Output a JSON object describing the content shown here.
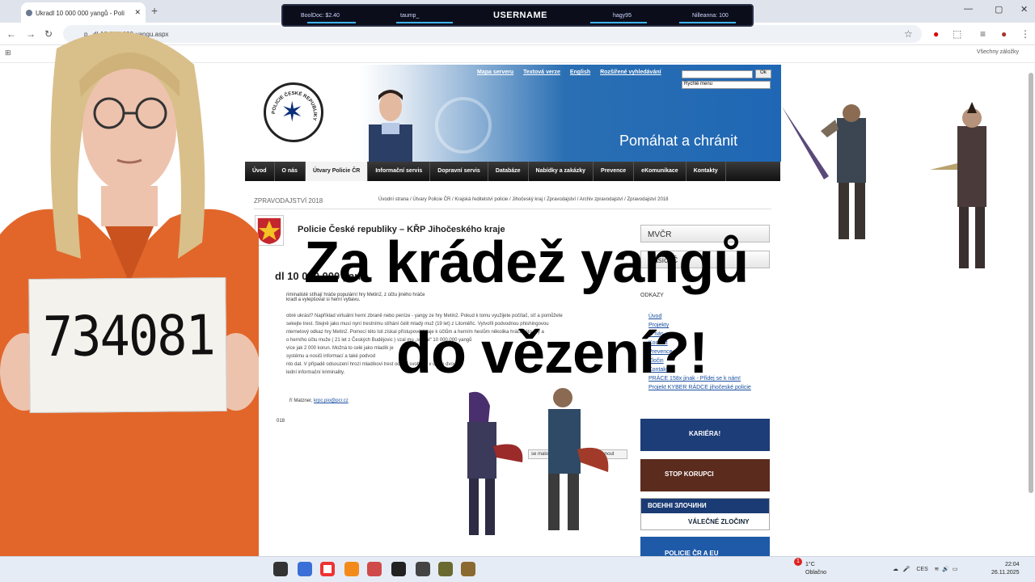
{
  "browser": {
    "tab_title": "Ukradl 10 000 000 yangů - Poli",
    "url": "p...dl-10-000-000-yangu.aspx",
    "bookmarks_all": "Všechny záložky"
  },
  "game_overlay": {
    "left1": "BoolDoc: $2.40",
    "left2": "taump_",
    "username": "USERNAME",
    "right1": "hagy95",
    "right2": "Nilleanna: 100"
  },
  "site": {
    "top_links": [
      "Mapa serveru",
      "Textová verze",
      "English",
      "Rozšířené vyhledávání"
    ],
    "search_button": "Ok",
    "quick_menu": "Rychlé menu",
    "slogan": "Pomáhat a chránit",
    "emblem_text": "POLICIE ČESKÉ REPUBLIKY",
    "menu": [
      "Úvod",
      "O nás",
      "Útvary Policie ČR",
      "Informační servis",
      "Dopravní servis",
      "Databáze",
      "Nabídky a zakázky",
      "Prevence",
      "eKomunikace",
      "Kontakty"
    ],
    "section": "ZPRAVODAJSTVÍ 2018",
    "breadcrumb": "Úvodní strana  /  Útvary Policie ČR  /  Krajská ředitelství policie  /  Jihočeský kraj  /  Zpravodajství  /  Archiv zpravodajství  /  Zpravodajství 2018",
    "org_name": "Policie České republiky – KŘP Jihočeského kraje",
    "article_title": "dl 10 000 000 yan",
    "lead": "riminalisté stíhají hráče populární hry Metin2, z účtu jiného hráče kradl a vylepšoval si herní vybavu.",
    "body": [
      "obré ukrást? Například virtuální herní zbraně nebo peníze - yangy ze hry Metin2. Pokud k tomu využijete počítač, síť a pomůžete",
      "sekejte trest. Stejně jako musí nyní trestnímu stíhání čelit mladý muž (19 let) z Litoměřic. Vytvořil podvodnou phishingovou",
      "nternetový odkaz hry Metin2. Pomocí této lsti získal přístupové údaje k účtům a herním heslům několika hráčů této hry a",
      "o herního účtu muže ( 21 let z Českých Budějovic ) vzal mu „sebral“ 10 000 000 yangů",
      "více jak 2 000 korun. Možná to celé jako mladík je",
      "systému a nosiči informací a také podvod",
      "nto dat. V případě odsouzení hrozí mladíkovi trest odnětí svobody v délce dvou let",
      "lední informační kriminality."
    ],
    "author": "ří Matzner,",
    "author_email": "krpc.pio@pcr.cz",
    "year_short": "018",
    "side_box1": "MVČR",
    "side_box2": "Hasiči Č",
    "links_header": "ODKAZY",
    "links": [
      "Úvod",
      "Projekty",
      "O nás",
      "Kontakt",
      "Prevence",
      "Zločin",
      "Kontakty",
      "PRÁCE 158x jinak - Přidej se k nám!",
      "Projekt KYBER RÁDCE jihočeské policie"
    ],
    "banner_kariera": "KARIÉRA!",
    "banner_korupci": "STOP KORUPCI",
    "banner_zlocin1": "ВОЕННІ ЗЛОЧИНИ",
    "banner_zlocin2": "VÁLEČNÉ ZLOČINY",
    "banner_eu": "POLICIE ČR A EU",
    "btn_print": "se malo",
    "btn_close": "Vytisknout"
  },
  "thumbnail": {
    "sign_number": "734081",
    "headline_line1": "Za krádež yangů",
    "headline_line2": "do vězení?!"
  },
  "taskbar": {
    "weather_temp": "1°C",
    "weather_desc": "Oblačno",
    "lang": "CES",
    "time": "22:04",
    "date": "26.11.2025",
    "badge": "1"
  },
  "colors": {
    "police_blue": "#1f67b5",
    "menu_dark": "#1a1a1a",
    "prison_orange": "#e2662a"
  }
}
